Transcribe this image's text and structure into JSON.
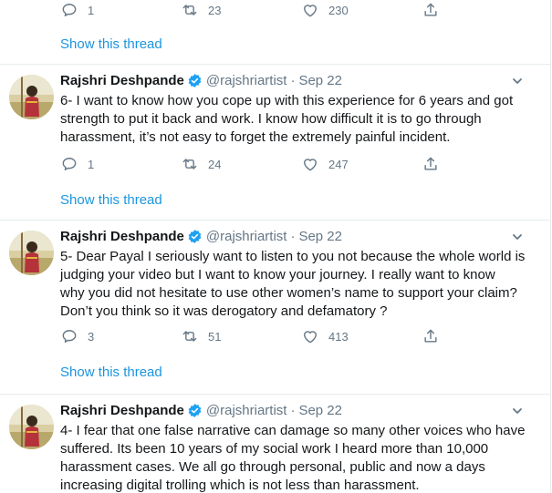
{
  "colors": {
    "link": "#1b95e0",
    "muted": "#657786",
    "text": "#14171a",
    "verified": "#1da1f2",
    "border": "#e6ecf0"
  },
  "icons": {
    "reply": "reply-icon",
    "retweet": "retweet-icon",
    "like": "heart-icon",
    "share": "share-icon",
    "verified": "verified-badge-icon",
    "menu": "chevron-down-icon"
  },
  "top": {
    "reply_count": "1",
    "retweet_count": "23",
    "like_count": "230",
    "show_thread": "Show this thread"
  },
  "tweets": [
    {
      "name": "Rajshri Deshpande",
      "handle": "@rajshriartist",
      "separator": "·",
      "date": "Sep 22",
      "text": "6- I want to know how you cope up with this experience for 6 years and got\nstrength to put it back and work. I know how difficult it is to go through\nharassment, it’s not easy to forget the extremely painful incident.",
      "reply_count": "1",
      "retweet_count": "24",
      "like_count": "247",
      "show_thread": "Show this thread"
    },
    {
      "name": "Rajshri Deshpande",
      "handle": "@rajshriartist",
      "separator": "·",
      "date": "Sep 22",
      "text": "5- Dear Payal I seriously want to listen to you not because the whole world is\njudging your video but I want to know your journey. I really want to know\nwhy you did not hesitate to use other women’s name to support your claim?\nDon’t you think so it was derogatory and defamatory ?",
      "reply_count": "3",
      "retweet_count": "51",
      "like_count": "413",
      "show_thread": "Show this thread"
    },
    {
      "name": "Rajshri Deshpande",
      "handle": "@rajshriartist",
      "separator": "·",
      "date": "Sep 22",
      "text": "4- I fear that one false narrative can damage so many other voices who have\nsuffered. Its been 10 years of my social work I heard more than 10,000\nharassment cases. We all go through personal, public and now a days\nincreasing digital trolling which is not less than harassment."
    }
  ]
}
